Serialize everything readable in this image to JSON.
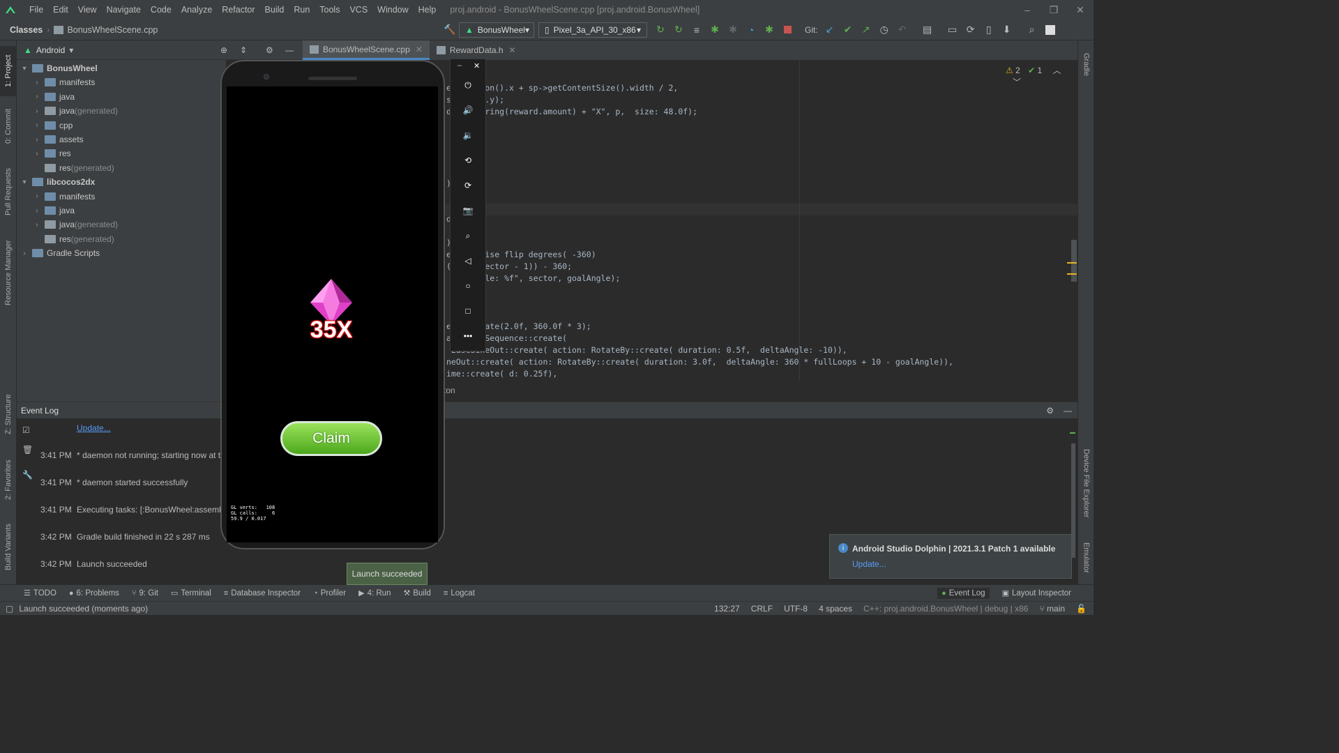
{
  "window": {
    "menu": [
      "File",
      "Edit",
      "View",
      "Navigate",
      "Code",
      "Analyze",
      "Refactor",
      "Build",
      "Run",
      "Tools",
      "VCS",
      "Window",
      "Help"
    ],
    "title": "proj.android - BonusWheelScene.cpp [proj.android.BonusWheel]"
  },
  "navbar": {
    "crumb_root": "Classes",
    "crumb_file": "BonusWheelScene.cpp",
    "run_config": "BonusWheel",
    "device": "Pixel_3a_API_30_x86",
    "git_label": "Git:"
  },
  "project": {
    "view": "Android",
    "tree": [
      {
        "label": "BonusWheel",
        "suffix": "",
        "bold": true
      },
      {
        "label": "manifests",
        "suffix": ""
      },
      {
        "label": "java",
        "suffix": ""
      },
      {
        "label": "java",
        "suffix": " (generated)"
      },
      {
        "label": "cpp",
        "suffix": ""
      },
      {
        "label": "assets",
        "suffix": ""
      },
      {
        "label": "res",
        "suffix": ""
      },
      {
        "label": "res",
        "suffix": " (generated)"
      },
      {
        "label": "libcocos2dx",
        "suffix": "",
        "bold": true
      },
      {
        "label": "manifests",
        "suffix": ""
      },
      {
        "label": "java",
        "suffix": ""
      },
      {
        "label": "java",
        "suffix": " (generated)"
      },
      {
        "label": "res",
        "suffix": " (generated)"
      },
      {
        "label": "Gradle Scripts",
        "suffix": ""
      }
    ]
  },
  "tabs": [
    "BonusWheelScene.cpp",
    "RewardData.h"
  ],
  "editor": {
    "warnings": "2",
    "checks": "1",
    "lines": [
      "etPosition().x + sp->getContentSize().width / 2,",
      "sition().y);",
      "d::to_string(reward.amount) + \"X\", p,  size: 48.0f);",
      "));",
      "d);",
      ");",
      "erclockwise flip degrees( -360)",
      "(0.5 + sector - 1)) - 360;",
      " %d--Angle: %f\", sector, goalAngle);",
      "eBy::create(2.0f, 360.0f * 3);",
      "action: Sequence::create(",
      " EaseSineOut::create( action: RotateBy::create( duration: 0.5f,  deltaAngle: -10)),",
      "neOut::create( action: RotateBy::create( duration: 3.0f,  deltaAngle: 360 * fullLoops + 10 - goalAngle)),",
      "ime::create( d: 0.25f),"
    ],
    "crumb": "ton"
  },
  "emulator": {
    "reward_text": "35X",
    "claim_label": "Claim",
    "stats": [
      "GL verts:   108",
      "GL calls:     6",
      "59.9 / 0.017"
    ]
  },
  "event_log": {
    "title": "Event Log",
    "update_link": "Update...",
    "entries": [
      {
        "time": "3:41 PM",
        "text": "* daemon not running; starting now at t"
      },
      {
        "time": "3:41 PM",
        "text": "* daemon started successfully"
      },
      {
        "time": "3:41 PM",
        "text": "Executing tasks: [:BonusWheel:assembleD"
      },
      {
        "time": "3:42 PM",
        "text": "Gradle build finished in 22 s 287 ms"
      },
      {
        "time": "3:42 PM",
        "text": "Launch succeeded"
      }
    ]
  },
  "toast": "Launch succeeded",
  "notification": {
    "title": "Android Studio Dolphin | 2021.3.1 Patch 1 available",
    "link": "Update..."
  },
  "left_strip": [
    "1: Project",
    "0: Commit",
    "Pull Requests",
    "Resource Manager",
    "Z: Structure",
    "2: Favorites",
    "Build Variants"
  ],
  "right_strip": [
    "Gradle",
    "Device File Explorer",
    "Emulator"
  ],
  "bottom_tabs": [
    "TODO",
    "6: Problems",
    "9: Git",
    "Terminal",
    "Database Inspector",
    "Profiler",
    "4: Run",
    "Build",
    "Logcat"
  ],
  "bottom_right_tabs": [
    "Event Log",
    "Layout Inspector"
  ],
  "status": {
    "message": "Launch succeeded (moments ago)",
    "position": "132:27",
    "line_sep": "CRLF",
    "encoding": "UTF-8",
    "indent": "4 spaces",
    "context": "C++: proj.android.BonusWheel | debug | x86",
    "branch": "main"
  },
  "colors": {
    "accent": "#4a88c7",
    "claim_green": "#66cc33",
    "gem": "#e040c8"
  }
}
